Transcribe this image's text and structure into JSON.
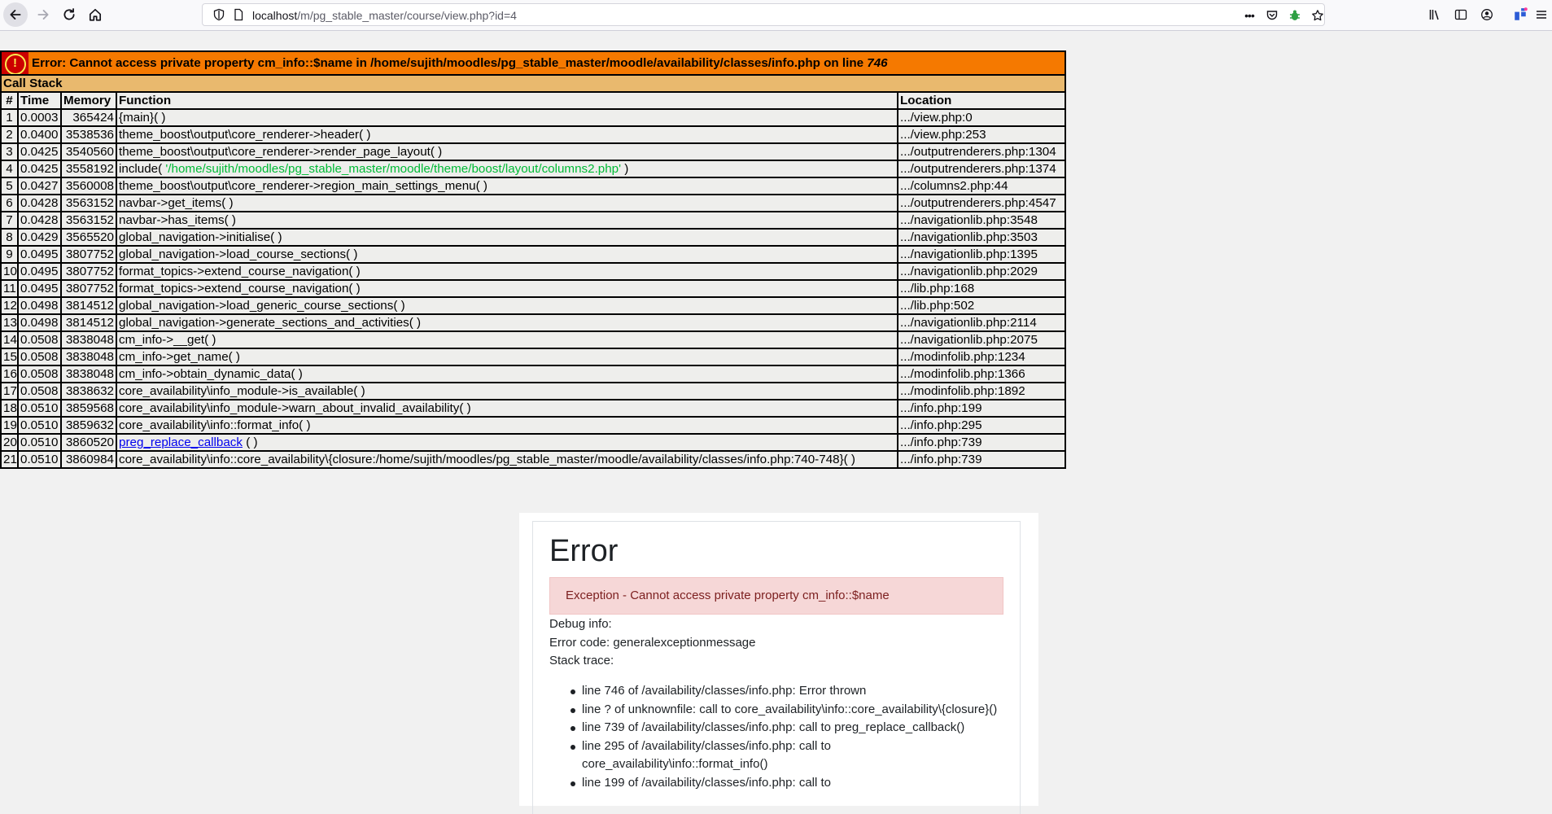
{
  "browser": {
    "url_host": "localhost",
    "url_path": "/m/pg_stable_master/course/view.php?id=4",
    "menu_dots": "•••"
  },
  "xdebug": {
    "error_icon": "!",
    "error_prefix": "Error: Cannot access private property cm_info::$name in /home/sujith/moodles/pg_stable_master/moodle/availability/classes/info.php on line ",
    "error_line": "746",
    "call_stack_label": "Call Stack",
    "headers": {
      "num": "#",
      "time": "Time",
      "memory": "Memory",
      "function": "Function",
      "location": "Location"
    },
    "rows": [
      {
        "num": "1",
        "time": "0.0003",
        "memory": "365424",
        "func": "{main}( )",
        "file": ".../view.php",
        "line": "0"
      },
      {
        "num": "2",
        "time": "0.0400",
        "memory": "3538536",
        "func": "theme_boost\\output\\core_renderer->header( )",
        "file": ".../view.php",
        "line": "253"
      },
      {
        "num": "3",
        "time": "0.0425",
        "memory": "3540560",
        "func": "theme_boost\\output\\core_renderer->render_page_layout( )",
        "file": ".../outputrenderers.php",
        "line": "1304"
      },
      {
        "num": "4",
        "time": "0.0425",
        "memory": "3558192",
        "func_pre": "include( ",
        "func_str": "'/home/sujith/moodles/pg_stable_master/moodle/theme/boost/layout/columns2.php'",
        "func_post": " )",
        "file": ".../outputrenderers.php",
        "line": "1374"
      },
      {
        "num": "5",
        "time": "0.0427",
        "memory": "3560008",
        "func": "theme_boost\\output\\core_renderer->region_main_settings_menu( )",
        "file": ".../columns2.php",
        "line": "44"
      },
      {
        "num": "6",
        "time": "0.0428",
        "memory": "3563152",
        "func": "navbar->get_items( )",
        "file": ".../outputrenderers.php",
        "line": "4547"
      },
      {
        "num": "7",
        "time": "0.0428",
        "memory": "3563152",
        "func": "navbar->has_items( )",
        "file": ".../navigationlib.php",
        "line": "3548"
      },
      {
        "num": "8",
        "time": "0.0429",
        "memory": "3565520",
        "func": "global_navigation->initialise( )",
        "file": ".../navigationlib.php",
        "line": "3503"
      },
      {
        "num": "9",
        "time": "0.0495",
        "memory": "3807752",
        "func": "global_navigation->load_course_sections( )",
        "file": ".../navigationlib.php",
        "line": "1395"
      },
      {
        "num": "10",
        "time": "0.0495",
        "memory": "3807752",
        "func": "format_topics->extend_course_navigation( )",
        "file": ".../navigationlib.php",
        "line": "2029"
      },
      {
        "num": "11",
        "time": "0.0495",
        "memory": "3807752",
        "func": "format_topics->extend_course_navigation( )",
        "file": ".../lib.php",
        "line": "168"
      },
      {
        "num": "12",
        "time": "0.0498",
        "memory": "3814512",
        "func": "global_navigation->load_generic_course_sections( )",
        "file": ".../lib.php",
        "line": "502"
      },
      {
        "num": "13",
        "time": "0.0498",
        "memory": "3814512",
        "func": "global_navigation->generate_sections_and_activities( )",
        "file": ".../navigationlib.php",
        "line": "2114"
      },
      {
        "num": "14",
        "time": "0.0508",
        "memory": "3838048",
        "func": "cm_info->__get( )",
        "file": ".../navigationlib.php",
        "line": "2075"
      },
      {
        "num": "15",
        "time": "0.0508",
        "memory": "3838048",
        "func": "cm_info->get_name( )",
        "file": ".../modinfolib.php",
        "line": "1234"
      },
      {
        "num": "16",
        "time": "0.0508",
        "memory": "3838048",
        "func": "cm_info->obtain_dynamic_data( )",
        "file": ".../modinfolib.php",
        "line": "1366"
      },
      {
        "num": "17",
        "time": "0.0508",
        "memory": "3838632",
        "func": "core_availability\\info_module->is_available( )",
        "file": ".../modinfolib.php",
        "line": "1892"
      },
      {
        "num": "18",
        "time": "0.0510",
        "memory": "3859568",
        "func": "core_availability\\info_module->warn_about_invalid_availability( )",
        "file": ".../info.php",
        "line": "199"
      },
      {
        "num": "19",
        "time": "0.0510",
        "memory": "3859632",
        "func": "core_availability\\info::format_info( )",
        "file": ".../info.php",
        "line": "295"
      },
      {
        "num": "20",
        "time": "0.0510",
        "memory": "3860520",
        "func_link": "preg_replace_callback",
        "func_post": " ( )",
        "file": ".../info.php",
        "line": "739"
      },
      {
        "num": "21",
        "time": "0.0510",
        "memory": "3860984",
        "func": "core_availability\\info::core_availability\\{closure:/home/sujith/moodles/pg_stable_master/moodle/availability/classes/info.php:740-748}( )",
        "file": ".../info.php",
        "line": "739"
      }
    ]
  },
  "moodle_error": {
    "heading": "Error",
    "alert": "Exception - Cannot access private property cm_info::$name",
    "debug_info": "Debug info:",
    "error_code": "Error code: generalexceptionmessage",
    "stack_trace_label": "Stack trace:",
    "trace": [
      "line 746 of /availability/classes/info.php: Error thrown",
      "line ? of unknownfile: call to core_availability\\info::core_availability\\{closure}()",
      "line 739 of /availability/classes/info.php: call to preg_replace_callback()",
      "line 295 of /availability/classes/info.php: call to core_availability\\info::format_info()",
      "line 199 of /availability/classes/info.php: call to"
    ]
  }
}
